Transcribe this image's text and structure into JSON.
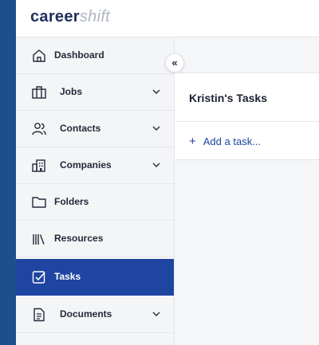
{
  "brand": {
    "logo_main": "career",
    "logo_accent": "shift"
  },
  "sidebar": {
    "collapse_label": "«",
    "items": [
      {
        "label": "Dashboard",
        "icon": "home-icon",
        "has_submenu": false,
        "active": false
      },
      {
        "label": "Jobs",
        "icon": "briefcase-icon",
        "has_submenu": true,
        "active": false
      },
      {
        "label": "Contacts",
        "icon": "contacts-icon",
        "has_submenu": true,
        "active": false
      },
      {
        "label": "Companies",
        "icon": "building-icon",
        "has_submenu": true,
        "active": false
      },
      {
        "label": "Folders",
        "icon": "folder-icon",
        "has_submenu": false,
        "active": false
      },
      {
        "label": "Resources",
        "icon": "library-icon",
        "has_submenu": false,
        "active": false
      },
      {
        "label": "Tasks",
        "icon": "checkbox-icon",
        "has_submenu": false,
        "active": true
      },
      {
        "label": "Documents",
        "icon": "document-icon",
        "has_submenu": true,
        "active": false
      }
    ]
  },
  "main": {
    "title": "Kristin's Tasks",
    "add_task_icon": "+",
    "add_task_label": "Add a task..."
  },
  "colors": {
    "accent": "#1e45a0",
    "frame": "#1d4f8f",
    "sidebar_bg": "#f4f5f7"
  }
}
